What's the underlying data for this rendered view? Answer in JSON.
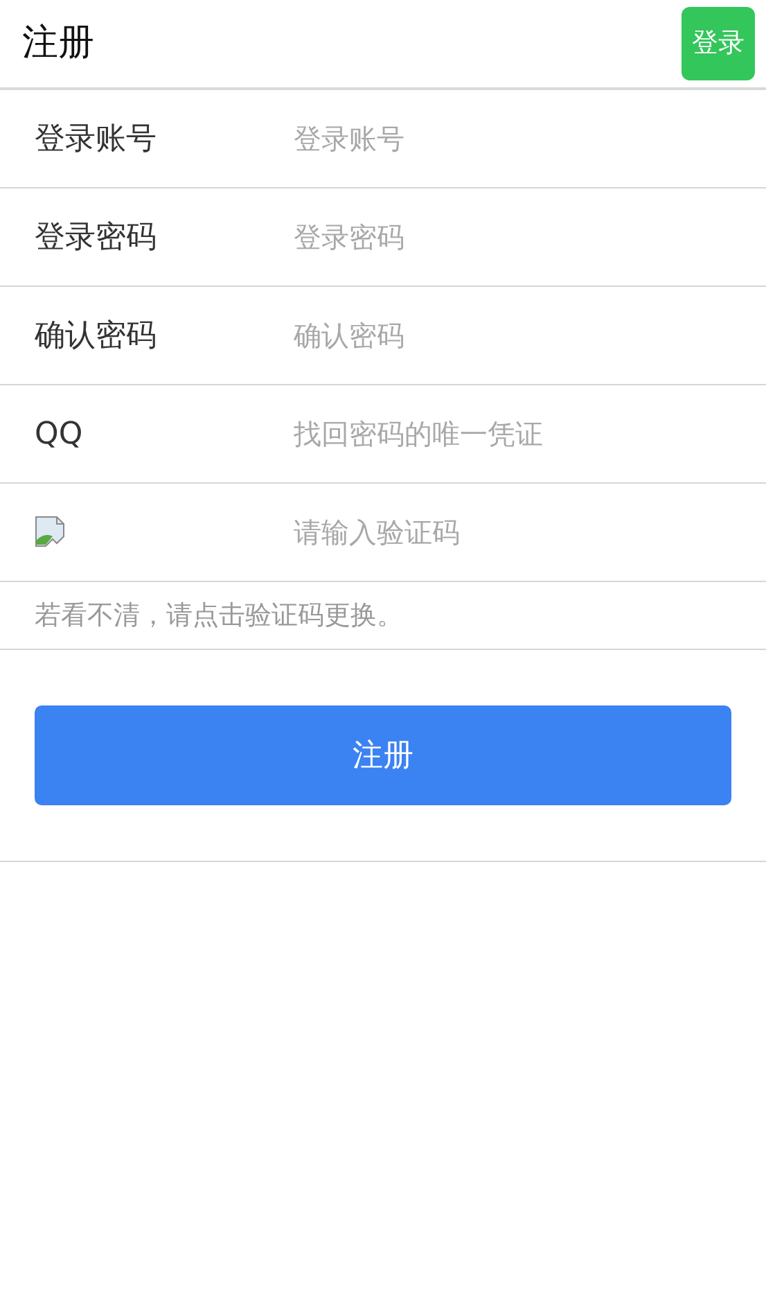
{
  "header": {
    "title": "注册",
    "login_button": "登录"
  },
  "fields": [
    {
      "kind": "text",
      "label": "登录账号",
      "placeholder": "登录账号"
    },
    {
      "kind": "text",
      "label": "登录密码",
      "placeholder": "登录密码"
    },
    {
      "kind": "text",
      "label": "确认密码",
      "placeholder": "确认密码"
    },
    {
      "kind": "text",
      "label": "QQ",
      "placeholder": "找回密码的唯一凭证"
    },
    {
      "kind": "captcha",
      "placeholder": "请输入验证码"
    }
  ],
  "hint": "若看不清，请点击验证码更换。",
  "submit_button": "注册"
}
